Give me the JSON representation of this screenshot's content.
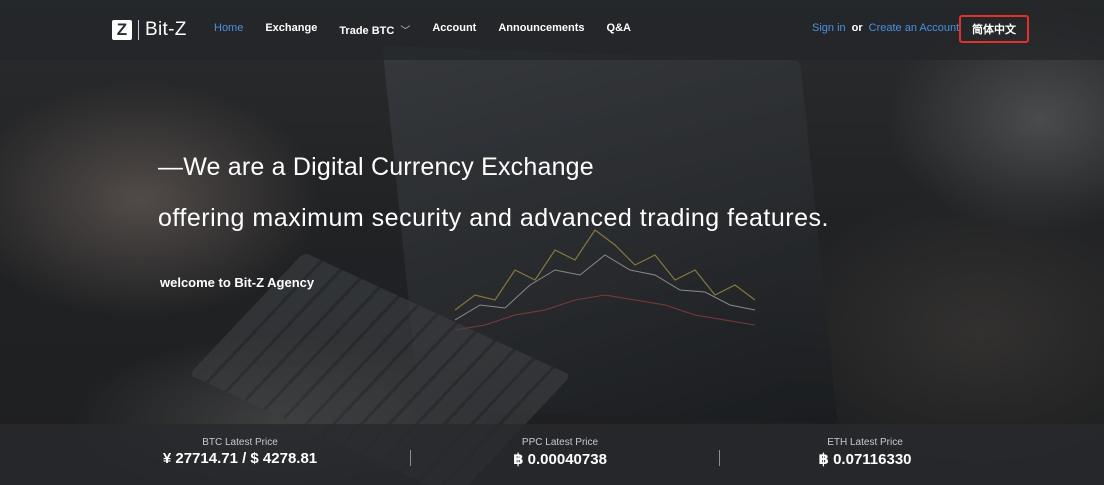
{
  "brand": {
    "logo_letter": "Z",
    "name": "Bit-Z"
  },
  "nav": {
    "items": [
      {
        "label": "Home",
        "active": true
      },
      {
        "label": "Exchange",
        "active": false
      },
      {
        "label": "Trade BTC",
        "active": false,
        "has_dropdown": true
      },
      {
        "label": "Account",
        "active": false
      },
      {
        "label": "Announcements",
        "active": false
      },
      {
        "label": "Q&A",
        "active": false
      }
    ],
    "dropdown_icon": "chevron-down-icon",
    "sign_in": "Sign in",
    "or": "or",
    "create_account": "Create an Account",
    "language": "简体中文"
  },
  "hero": {
    "headline_line1": "—We are a Digital Currency Exchange",
    "headline_line2": "offering maximum security and advanced trading features.",
    "welcome": "welcome to Bit-Z Agency"
  },
  "prices": [
    {
      "label": "BTC Latest Price",
      "value": "¥ 27714.71 / $ 4278.81"
    },
    {
      "label": "PPC Latest Price",
      "value": "฿ 0.00040738"
    },
    {
      "label": "ETH Latest Price",
      "value": "฿ 0.07116330"
    }
  ],
  "colors": {
    "accent_blue": "#4a90e2",
    "highlight_red": "#e0312b",
    "nav_bg": "#232528"
  }
}
